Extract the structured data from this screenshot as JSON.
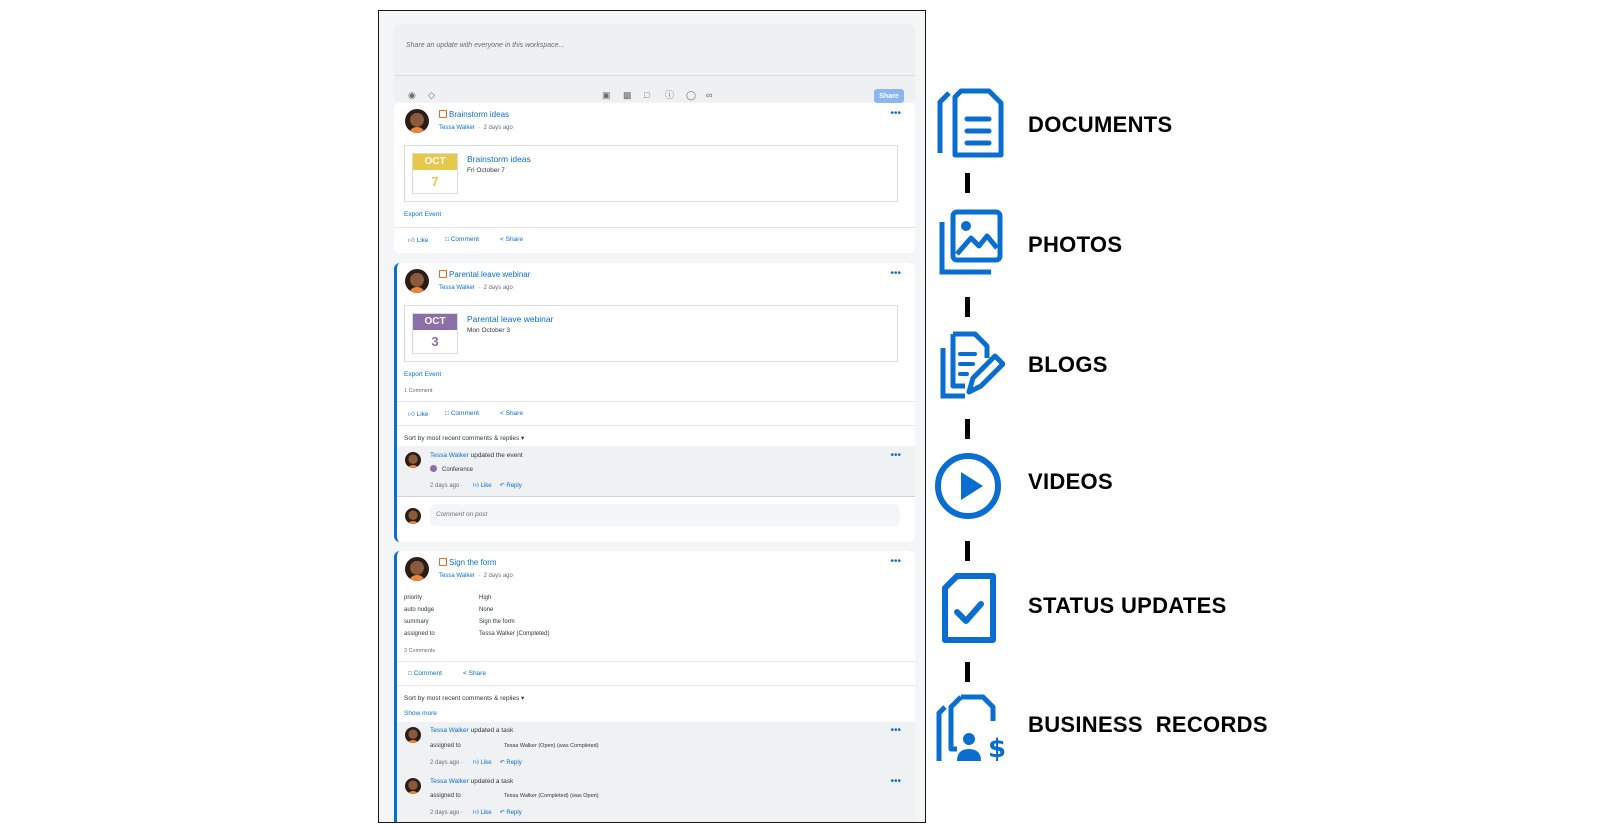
{
  "composer": {
    "placeholder": "Share an update with everyone in this workspace...",
    "share_label": "Share"
  },
  "posts": [
    {
      "title": "Brainstorm ideas",
      "author": "Tessa Walker",
      "time": "2 days ago",
      "event": {
        "month": "OCT",
        "day": "7",
        "title": "Brainstorm ideas",
        "date": "Fri October 7",
        "month_color": "#e8c84a",
        "day_color": "#e8c84a"
      },
      "export": "Export Event",
      "actions": {
        "like": "Like",
        "comment": "Comment",
        "share": "Share"
      }
    },
    {
      "title": "Parental leave webinar",
      "author": "Tessa Walker",
      "time": "2 days ago",
      "event": {
        "month": "OCT",
        "day": "3",
        "title": "Parental leave webinar",
        "date": "Mon October 3",
        "month_color": "#8c6ea8",
        "day_color": "#8c6ea8"
      },
      "export": "Export Event",
      "comment_count": "1 Comment",
      "actions": {
        "like": "Like",
        "comment": "Comment",
        "share": "Share"
      },
      "sort": "Sort by most recent comments & replies",
      "comments": [
        {
          "author": "Tessa Walker",
          "text": " updated the event",
          "detail": "Conference",
          "time": "2 days ago",
          "like": "Like",
          "reply": "Reply"
        }
      ],
      "comment_placeholder": "Comment on post"
    },
    {
      "title": "Sign the form",
      "author": "Tessa Walker",
      "time": "2 days ago",
      "fields": [
        {
          "label": "priority",
          "value": "High"
        },
        {
          "label": "auto nudge",
          "value": "None"
        },
        {
          "label": "summary",
          "value": "Sign the form"
        },
        {
          "label": "assigned to",
          "value": "Tessa Walker (Completed)"
        }
      ],
      "comment_count": "3 Comments",
      "actions": {
        "comment": "Comment",
        "share": "Share"
      },
      "sort": "Sort by most recent comments & replies",
      "show_more": "Show more",
      "comments": [
        {
          "author": "Tessa Walker",
          "text": " updated a task",
          "field": "assigned to",
          "value": "Tessa Walker (Open) (was Completed)",
          "time": "2 days ago",
          "like": "Like",
          "reply": "Reply"
        },
        {
          "author": "Tessa Walker",
          "text": " updated a task",
          "field": "assigned to",
          "value": "Tessa Walker (Completed) (was Open)",
          "time": "2 days ago",
          "like": "Like",
          "reply": "Reply"
        }
      ]
    }
  ],
  "legend": {
    "accent": "#0a6ed1",
    "items": [
      {
        "label": "DOCUMENTS",
        "icon": "document-icon"
      },
      {
        "label": "PHOTOS",
        "icon": "photos-icon"
      },
      {
        "label": "BLOGS",
        "icon": "blog-edit-icon"
      },
      {
        "label": "VIDEOS",
        "icon": "play-icon"
      },
      {
        "label": "STATUS UPDATES",
        "icon": "status-check-icon"
      },
      {
        "label": "BUSINESS  RECORDS",
        "icon": "business-record-icon"
      }
    ]
  }
}
